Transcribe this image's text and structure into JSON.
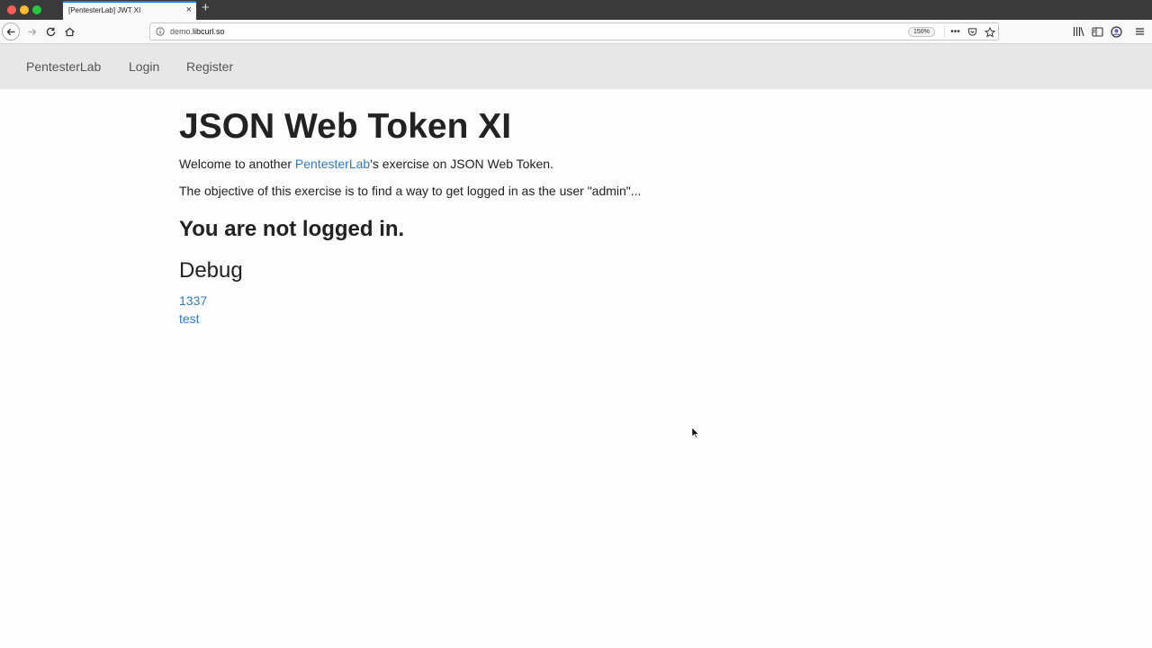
{
  "browser": {
    "tab_title": "[PentesterLab] JWT XI",
    "tab_close": "×",
    "new_tab": "+",
    "url_host_prefix": "demo.",
    "url_host_domain": "libcurl.so",
    "zoom": "150%",
    "more": "•••"
  },
  "site_nav": {
    "brand": "PentesterLab",
    "login": "Login",
    "register": "Register"
  },
  "page": {
    "title": "JSON Web Token XI",
    "welcome_prefix": "Welcome to another ",
    "welcome_link": "PentesterLab",
    "welcome_suffix": "'s exercise on JSON Web Token.",
    "objective": "The objective of this exercise is to find a way to get logged in as the user \"admin\"...",
    "status": "You are not logged in.",
    "debug_heading": "Debug",
    "debug_links": [
      "1337",
      "test"
    ]
  },
  "colors": {
    "link": "#337ab7",
    "nav_bg": "#e7e7e7",
    "tab_accent": "#0a84ff"
  }
}
